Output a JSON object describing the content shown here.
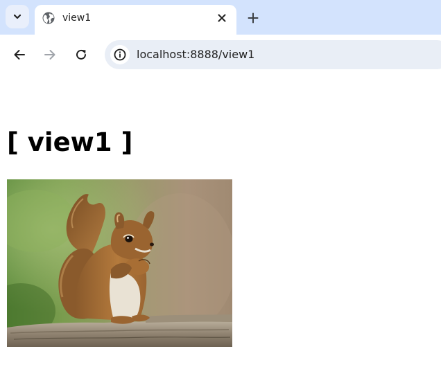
{
  "browser": {
    "tab": {
      "title": "view1"
    },
    "address_bar": {
      "url": "localhost:8888/view1"
    },
    "icons": {
      "tab_search": "chevron-down-icon",
      "favicon": "globe-icon",
      "close": "close-icon",
      "new_tab": "plus-icon",
      "back": "arrow-left-icon",
      "forward": "arrow-right-icon",
      "reload": "reload-icon",
      "site_info": "info-icon"
    },
    "colors": {
      "tabstrip": "#d3e3fd",
      "omnibox": "#e9eef6",
      "forward_disabled": "#a0a4aa"
    }
  },
  "page": {
    "heading": "[ view1 ]",
    "image": {
      "subject": "squirrel"
    }
  }
}
